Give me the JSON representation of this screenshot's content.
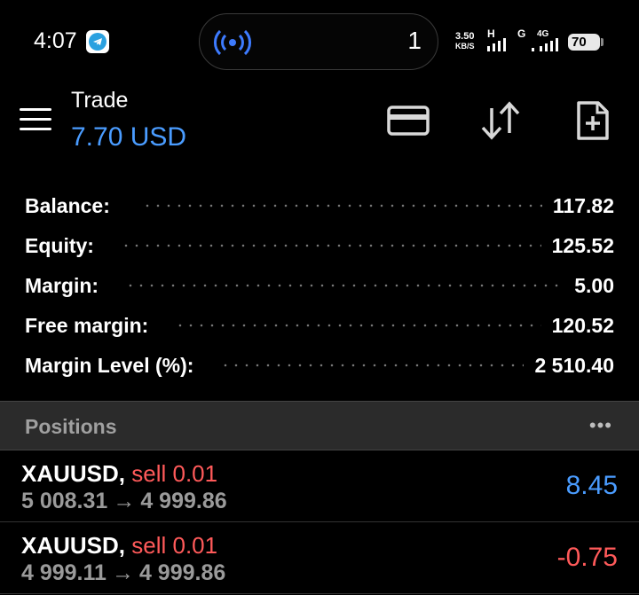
{
  "status_bar": {
    "time": "4:07",
    "live_count": "1",
    "net_speed_value": "3.50",
    "net_speed_unit": "KB/S",
    "net1_label": "H",
    "net2_label": "G",
    "net3_label": "4G",
    "battery": "70"
  },
  "header": {
    "title": "Trade",
    "subtitle": "7.70 USD"
  },
  "account": [
    {
      "label": "Balance:",
      "value": "117.82"
    },
    {
      "label": "Equity:",
      "value": "125.52"
    },
    {
      "label": "Margin:",
      "value": "5.00"
    },
    {
      "label": "Free margin:",
      "value": "120.52"
    },
    {
      "label": "Margin Level (%):",
      "value": "2 510.40"
    }
  ],
  "positions": {
    "title": "Positions",
    "more": "•••",
    "items": [
      {
        "symbol": "XAUUSD,",
        "side": "sell 0.01",
        "open": "5 008.31",
        "arrow": "→",
        "current": "4 999.86",
        "pl": "8.45"
      },
      {
        "symbol": "XAUUSD,",
        "side": "sell 0.01",
        "open": "4 999.11",
        "arrow": "→",
        "current": "4 999.86",
        "pl": "-0.75"
      }
    ]
  },
  "colors": {
    "accent": "#4a9cff",
    "negative": "#ff5a5a",
    "background": "#000000"
  }
}
